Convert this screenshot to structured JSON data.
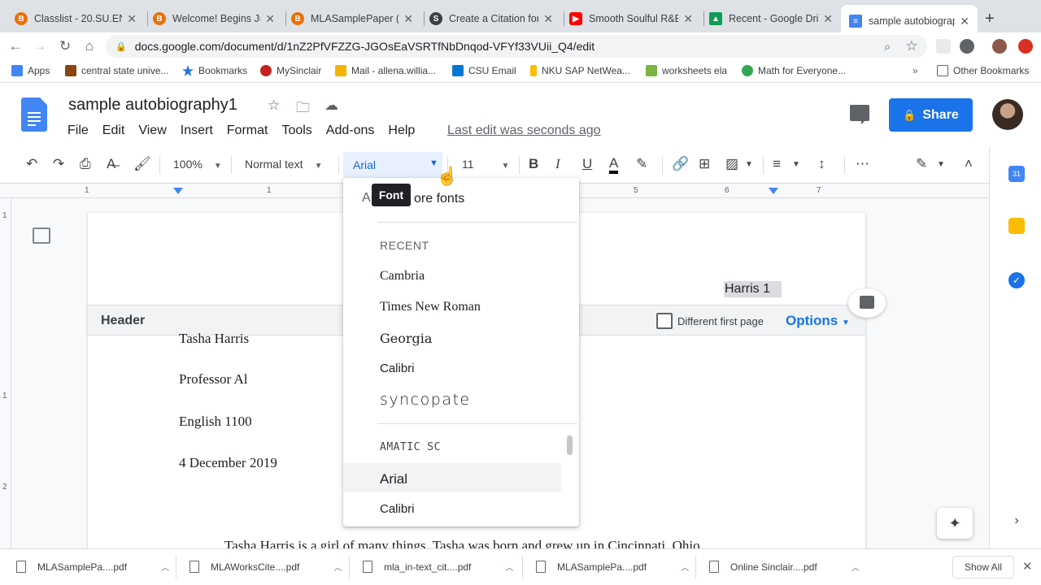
{
  "tabs": [
    {
      "title": "Classlist - 20.SU.EN...",
      "fav_color": "#e8710a",
      "fav_glyph": "B"
    },
    {
      "title": "Welcome! Begins Ju...",
      "fav_color": "#e8710a",
      "fav_glyph": "B"
    },
    {
      "title": "MLASamplePaper (1...",
      "fav_color": "#e8710a",
      "fav_glyph": "B"
    },
    {
      "title": "Create a Citation for...",
      "fav_color": "#3c4043",
      "fav_glyph": "S"
    },
    {
      "title": "Smooth Soulful R&B...",
      "fav_color": "#ff0000",
      "fav_glyph": "▶"
    },
    {
      "title": "Recent - Google Driv...",
      "fav_color": "#0f9d58",
      "fav_glyph": "▲"
    },
    {
      "title": "sample autobiograph...",
      "fav_color": "#4285f4",
      "fav_glyph": "≡"
    }
  ],
  "url": "docs.google.com/document/d/1nZ2PfVFZZG-JGOsEaVSRTfNbDnqod-VFYf33VUii_Q4/edit",
  "bookmarks": [
    {
      "label": "Apps",
      "color": "#4285f4"
    },
    {
      "label": "central state unive...",
      "color": "#8b4513"
    },
    {
      "label": "Bookmarks",
      "color": "#1a73e8"
    },
    {
      "label": "MySinclair",
      "color": "#c5221f"
    },
    {
      "label": "Mail - allena.willia...",
      "color": "#f4b400"
    },
    {
      "label": "CSU Email",
      "color": "#0078d4"
    },
    {
      "label": "NKU SAP NetWea...",
      "color": "#fbbc04"
    },
    {
      "label": "worksheets ela",
      "color": "#7cb342"
    },
    {
      "label": "Math for Everyone...",
      "color": "#34a853"
    }
  ],
  "other_bookmarks": "Other Bookmarks",
  "doc": {
    "title": "sample autobiography1",
    "menu": [
      "File",
      "Edit",
      "View",
      "Insert",
      "Format",
      "Tools",
      "Add-ons",
      "Help"
    ],
    "last_edit": "Last edit was seconds ago",
    "share": "Share"
  },
  "toolbar": {
    "zoom": "100%",
    "style": "Normal text",
    "font": "Arial",
    "size": "11"
  },
  "ruler": [
    "1",
    "1",
    "5",
    "6",
    "7"
  ],
  "vruler": [
    "1",
    "1",
    "2"
  ],
  "page": {
    "header_label": "Header",
    "page_number": "Harris 1",
    "different_first_page": "Different first page",
    "options": "Options",
    "lines": [
      "Tasha Harris",
      "Professor Al",
      "English 1100",
      "4 December 2019"
    ],
    "body": "Tasha Harris is a girl of many things. Tasha was born and grew up in Cincinnati, Ohio."
  },
  "font_menu": {
    "more_fonts": "ore fonts",
    "recent_header": "RECENT",
    "recent": [
      "Cambria",
      "Times New Roman",
      "Georgia",
      "Calibri",
      "syncopate"
    ],
    "all": [
      "AMATIC SC",
      "Arial",
      "Calibri"
    ],
    "selected": "Arial",
    "tooltip": "Font"
  },
  "downloads": [
    "MLASamplePa....pdf",
    "MLAWorksCite....pdf",
    "mla_in-text_cit....pdf",
    "MLASamplePa....pdf",
    "Online Sinclair....pdf"
  ],
  "show_all": "Show All"
}
